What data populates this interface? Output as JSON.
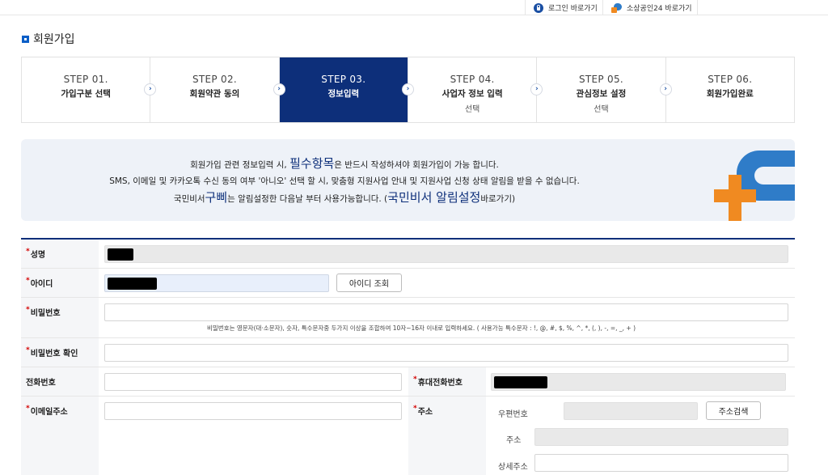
{
  "top_links": {
    "login": "로그인 바로가기",
    "sbiz24": "소상공인24 바로가기"
  },
  "page": {
    "title": "회원가입"
  },
  "steps": [
    {
      "no": "STEP 01.",
      "name": "가입구분 선택",
      "sub": ""
    },
    {
      "no": "STEP 02.",
      "name": "회원약관 동의",
      "sub": ""
    },
    {
      "no": "STEP 03.",
      "name": "정보입력",
      "sub": "",
      "active": true
    },
    {
      "no": "STEP 04.",
      "name": "사업자 정보 입력",
      "sub": "선택"
    },
    {
      "no": "STEP 05.",
      "name": "관심정보 설정",
      "sub": "선택"
    },
    {
      "no": "STEP 06.",
      "name": "회원가입완료",
      "sub": ""
    }
  ],
  "notice": {
    "line1_a": "회원가입 관련 정보입력 시,",
    "line1_big": "필수항목",
    "line1_b": "은 반드시 작성하셔야 회원가입이 가능 합니다.",
    "line2": "SMS, 이메일 및 카카오톡 수신 동의 여부 '아니오' 선택 할 시, 맞춤형 지원사업 안내 및 지원사업 신청 상태 알림을 받을 수 없습니다.",
    "line3_a": "국민비서",
    "line3_big1": "구삐",
    "line3_b": "는 알림설정한 다음날 부터 사용가능합니다. (",
    "line3_big2": "국민비서 알림설정",
    "line3_c": "바로가기)"
  },
  "form": {
    "name_label": "성명",
    "id_label": "아이디",
    "id_check_button": "아이디 조회",
    "password_label": "비밀번호",
    "password_hint": "비밀번호는 영문자(대·소문자), 숫자, 특수문자중 두가지 이상을 조합하여 10자~16자 이내로 입력하세요. ( 사용가능 특수문자 : !, @, #, $, %, ^, *, (, ), -, =, _, + )",
    "password_confirm_label": "비밀번호 확인",
    "phone_label": "전화번호",
    "mobile_label": "휴대전화번호",
    "email_label": "이메일주소",
    "address_label": "주소",
    "zipcode_label": "우편번호",
    "address_search_button": "주소검색",
    "address_sub_label": "주소",
    "address_detail_label": "상세주소"
  },
  "required_mark": "*"
}
